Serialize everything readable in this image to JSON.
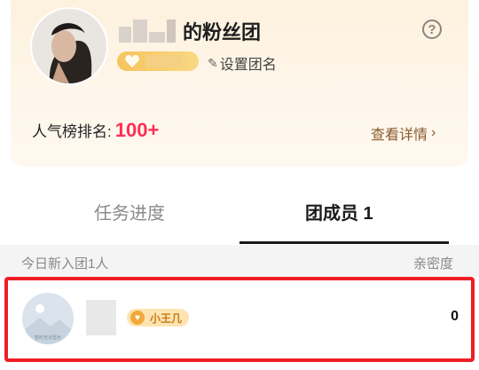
{
  "header": {
    "name_suffix": "的粉丝团",
    "help_glyph": "?",
    "set_name_label": "设置团名",
    "rank_label": "人气榜排名:",
    "rank_value": "100+",
    "detail_label": "查看详情"
  },
  "tabs": {
    "progress": "任务进度",
    "members": "团成员 1"
  },
  "members_section": {
    "today_label": "今日新入团1人",
    "intimacy_label": "亲密度",
    "rows": [
      {
        "badge": "小王几",
        "score": "0",
        "avatar_caption": "暂时无法显示"
      }
    ]
  },
  "icons": {
    "help": "question-circle-icon",
    "edit": "pencil-icon",
    "chevron": "chevron-right-icon",
    "badge": "heart-badge-icon"
  },
  "colors": {
    "rank_value": "#ff2d55",
    "highlight_border": "#ee1f26",
    "level_pill": "#f6c45c"
  }
}
